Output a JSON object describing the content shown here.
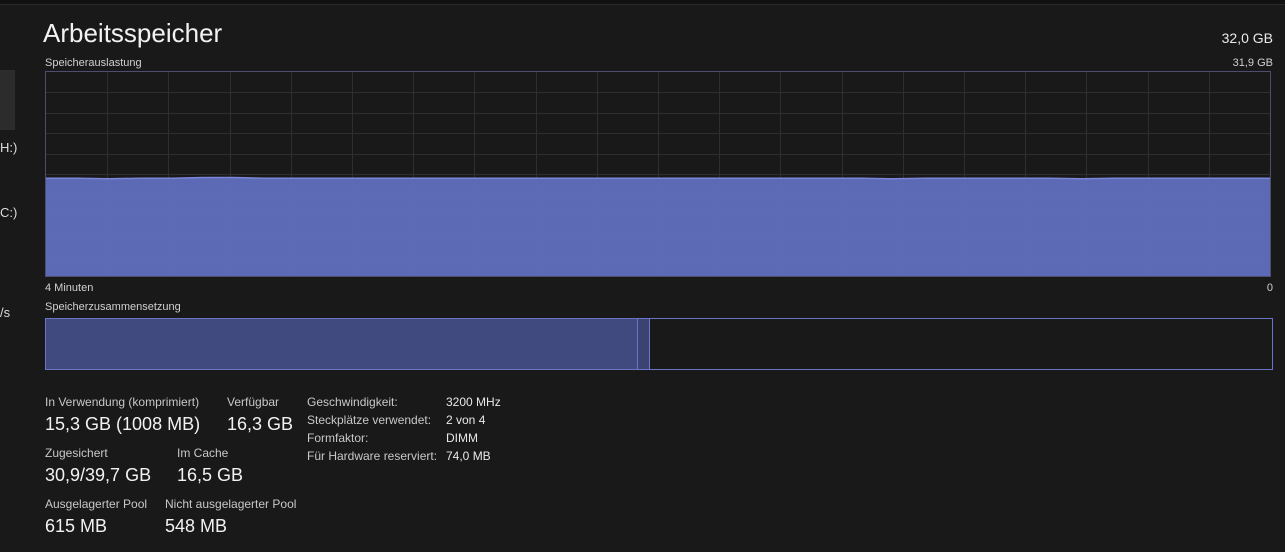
{
  "sidebar": {
    "fragments": [
      "H:)",
      "C:)",
      "/s"
    ]
  },
  "header": {
    "title": "Arbeitsspeicher",
    "total": "32,0 GB"
  },
  "usage_chart": {
    "label": "Speicherauslastung",
    "max_label": "31,9 GB",
    "time_left": "4 Minuten",
    "time_right": "0"
  },
  "chart_data": {
    "type": "area",
    "x_label_left": "4 Minuten",
    "x_label_right": "0",
    "ylim": [
      0,
      31.9
    ],
    "grid": true,
    "values": [
      15.3,
      15.3,
      15.2,
      15.3,
      15.3,
      15.4,
      15.4,
      15.3,
      15.3,
      15.3,
      15.3,
      15.3,
      15.3,
      15.3,
      15.3,
      15.3,
      15.3,
      15.3,
      15.3,
      15.3,
      15.3,
      15.3,
      15.3,
      15.3,
      15.3,
      15.3,
      15.3,
      15.2,
      15.3,
      15.3,
      15.3,
      15.3,
      15.3,
      15.2,
      15.3,
      15.3,
      15.3,
      15.3,
      15.3,
      15.3
    ],
    "colors": {
      "fill": "#6270c1",
      "line": "#7b86d9",
      "grid": "#2f2f2f",
      "border": "#4e4e72"
    }
  },
  "composition": {
    "label": "Speicherzusammensetzung",
    "in_use_fraction": 0.482,
    "modified_fraction": 0.011,
    "colors": {
      "in_use": "#414a7e",
      "border": "#6b74c8"
    }
  },
  "stats": {
    "in_use": {
      "label": "In Verwendung (komprimiert)",
      "value": "15,3 GB (1008 MB)"
    },
    "available": {
      "label": "Verfügbar",
      "value": "16,3 GB"
    },
    "committed": {
      "label": "Zugesichert",
      "value": "30,9/39,7 GB"
    },
    "cached": {
      "label": "Im Cache",
      "value": "16,5 GB"
    },
    "paged_pool": {
      "label": "Ausgelagerter Pool",
      "value": "615 MB"
    },
    "nonpaged_pool": {
      "label": "Nicht ausgelagerter Pool",
      "value": "548 MB"
    }
  },
  "specs": {
    "speed": {
      "label": "Geschwindigkeit:",
      "value": "3200 MHz"
    },
    "slots": {
      "label": "Steckplätze verwendet:",
      "value": "2 von 4"
    },
    "form": {
      "label": "Formfaktor:",
      "value": "DIMM"
    },
    "reserved": {
      "label": "Für Hardware reserviert:",
      "value": "74,0 MB"
    }
  }
}
